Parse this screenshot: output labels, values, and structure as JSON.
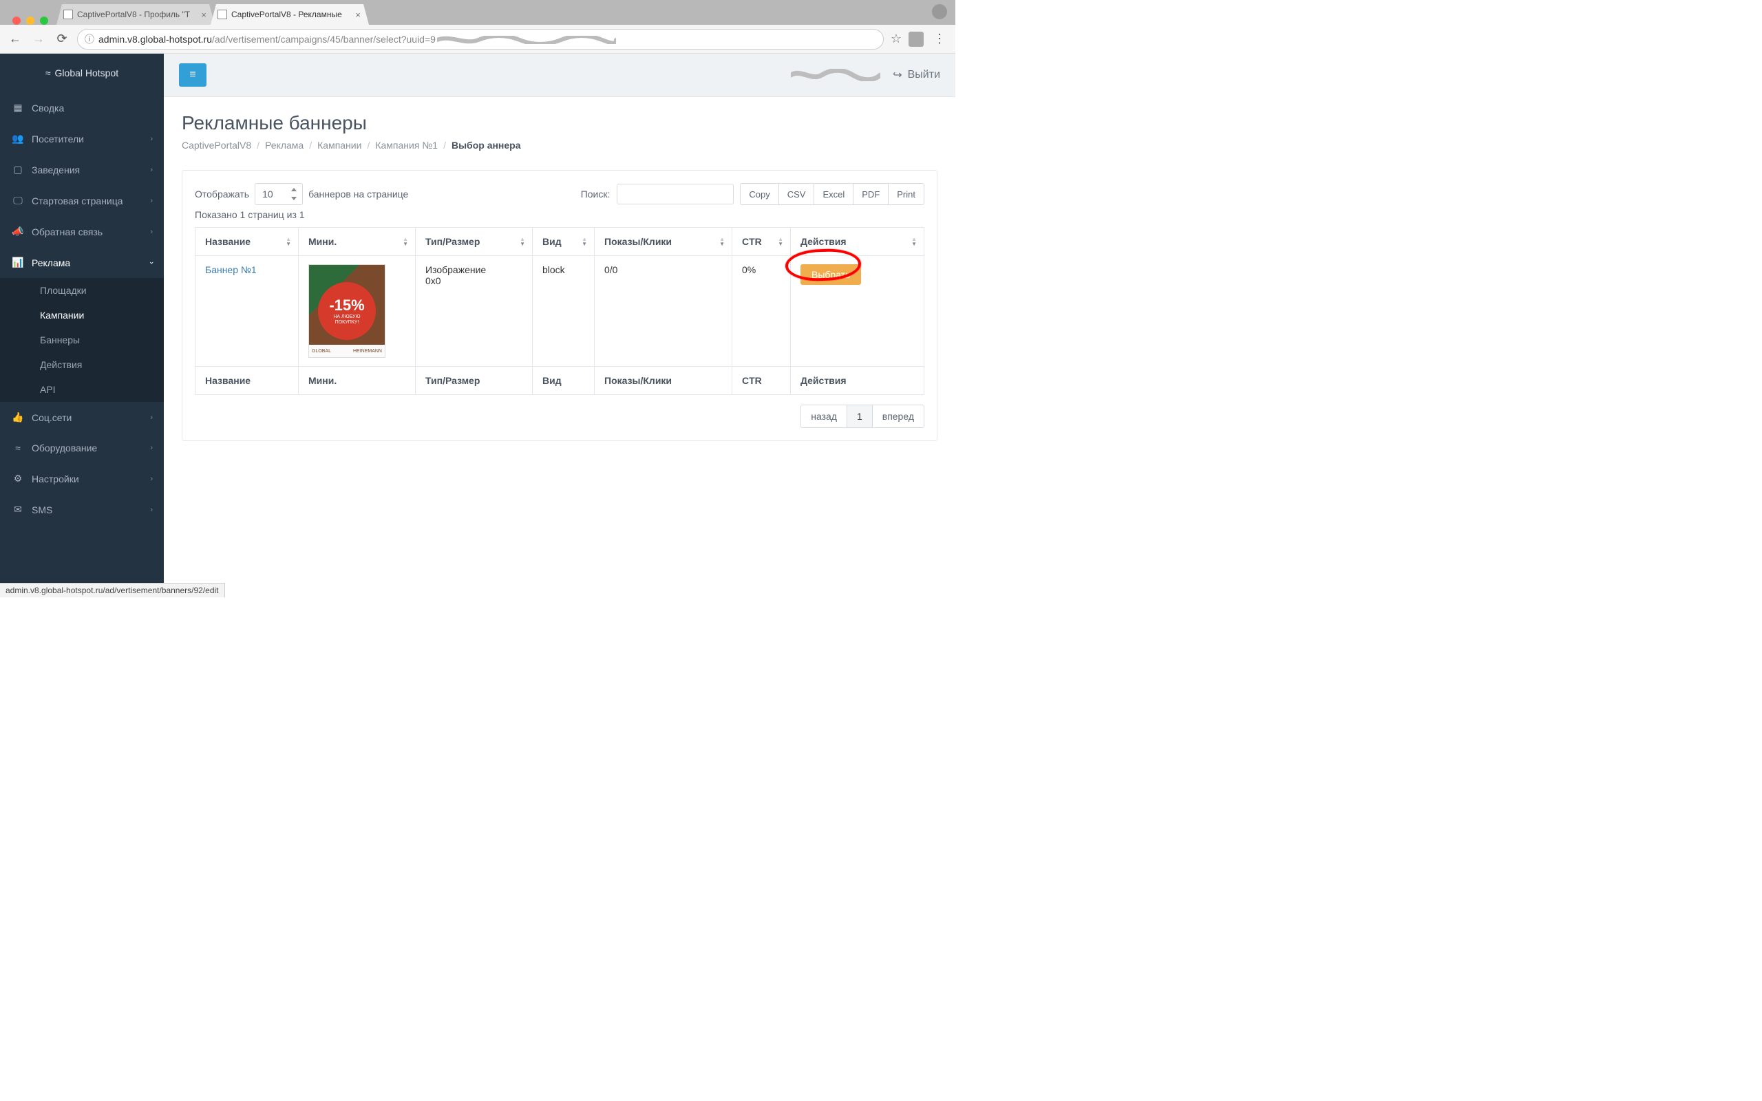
{
  "browser": {
    "tabs": [
      {
        "title": "CaptivePortalV8 - Профиль \"Т",
        "active": false
      },
      {
        "title": "CaptivePortalV8 - Рекламные",
        "active": true
      }
    ],
    "url_domain": "admin.v8.global-hotspot.ru",
    "url_path": "/ad/vertisement/campaigns/45/banner/select?uuid=9",
    "status_url": "admin.v8.global-hotspot.ru/ad/vertisement/banners/92/edit"
  },
  "brand": "Global Hotspot",
  "topbar": {
    "logout": "Выйти"
  },
  "sidebar": {
    "items": [
      {
        "icon": "grid",
        "label": "Сводка",
        "expandable": false
      },
      {
        "icon": "users",
        "label": "Посетители",
        "expandable": true
      },
      {
        "icon": "tablet",
        "label": "Заведения",
        "expandable": true
      },
      {
        "icon": "monitor",
        "label": "Стартовая страница",
        "expandable": true
      },
      {
        "icon": "megaphone",
        "label": "Обратная связь",
        "expandable": true
      },
      {
        "icon": "chart",
        "label": "Реклама",
        "expandable": true,
        "open": true,
        "children": [
          {
            "label": "Площадки"
          },
          {
            "label": "Кампании",
            "active": true
          },
          {
            "label": "Баннеры"
          },
          {
            "label": "Действия"
          },
          {
            "label": "API"
          }
        ]
      },
      {
        "icon": "thumbs",
        "label": "Соц.сети",
        "expandable": true
      },
      {
        "icon": "wifi",
        "label": "Оборудование",
        "expandable": true
      },
      {
        "icon": "gears",
        "label": "Настройки",
        "expandable": true
      },
      {
        "icon": "mail",
        "label": "SMS",
        "expandable": true
      }
    ]
  },
  "page": {
    "title": "Рекламные баннеры",
    "breadcrumb": [
      "CaptivePortalV8",
      "Реклама",
      "Кампании",
      "Кампания №1"
    ],
    "breadcrumb_current": "Выбор аннера"
  },
  "table": {
    "length_label_pre": "Отображать",
    "length_value": "10",
    "length_label_post": "баннеров на странице",
    "search_label": "Поиск:",
    "export": [
      "Copy",
      "CSV",
      "Excel",
      "PDF",
      "Print"
    ],
    "page_info": "Показано 1 страниц из 1",
    "columns": [
      "Название",
      "Мини.",
      "Тип/Размер",
      "Вид",
      "Показы/Клики",
      "CTR",
      "Действия"
    ],
    "rows": [
      {
        "name": "Баннер №1",
        "thumb": {
          "percent": "-15%",
          "line1": "НА ЛЮБУЮ",
          "line2": "ПОКУПКУ!",
          "brand_l": "GLOBAL",
          "brand_r": "HEINEMANN"
        },
        "type": "Изображение",
        "size": "0x0",
        "kind": "block",
        "impressions": "0/0",
        "ctr": "0%",
        "action_label": "Выбрать"
      }
    ],
    "pagination": {
      "prev": "назад",
      "pages": [
        "1"
      ],
      "next": "вперед",
      "active": "1"
    }
  }
}
